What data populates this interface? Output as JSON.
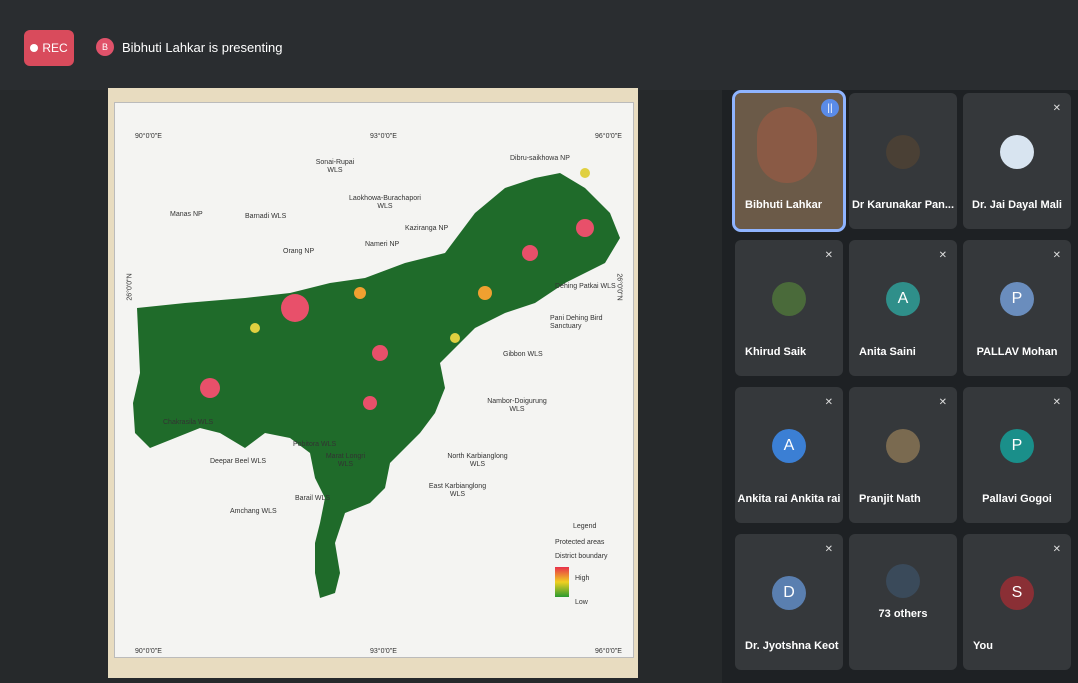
{
  "topbar": {
    "rec_label": "REC",
    "presenter_initial": "B",
    "presenter_text": "Bibhuti Lahkar is presenting"
  },
  "map": {
    "top_coords": [
      "90°0'0\"E",
      "93°0'0\"E",
      "96°0'0\"E"
    ],
    "bottom_coords": [
      "90°0'0\"E",
      "93°0'0\"E",
      "96°0'0\"E"
    ],
    "left_coord": "26°0'0\"N",
    "right_coord": "26°0'0\"N",
    "labels": [
      "Sonai-Rupai WLS",
      "Dibru-saikhowa NP",
      "Laokhowa-Burachapori WLS",
      "Manas NP",
      "Barnadi WLS",
      "Kaziranga NP",
      "Nameri NP",
      "Orang NP",
      "Dehing Patkai WLS",
      "Pani Dehing Bird Sanctuary",
      "Gibbon WLS",
      "Chakrasila WLS",
      "Nambor-Doigurung WLS",
      "Pobitora WLS",
      "Marat Longri WLS",
      "North Karbianglong WLS",
      "Deepar Beel WLS",
      "East Karbianglong WLS",
      "Barail WLS",
      "Amchang WLS"
    ],
    "legend": {
      "title": "Legend",
      "items": [
        "Protected areas",
        "District boundary"
      ],
      "high": "High",
      "low": "Low"
    }
  },
  "participants": [
    {
      "name": "Bibhuti Lahkar"
    },
    {
      "name": "Dr Karunakar Pan..."
    },
    {
      "name": "Dr. Jai Dayal Mali"
    },
    {
      "name": "Khirud Saik"
    },
    {
      "name": "Anita Saini",
      "initial": "A",
      "color": "#2f8f8a"
    },
    {
      "name": "PALLAV Mohan",
      "initial": "P",
      "color": "#6a8dbd"
    },
    {
      "name": "Ankita rai Ankita rai",
      "initial": "A",
      "color": "#3b7fd4"
    },
    {
      "name": "Pranjit Nath"
    },
    {
      "name": "Pallavi Gogoi",
      "initial": "P",
      "color": "#1a8f8a"
    },
    {
      "name": "Dr. Jyotshna Keot",
      "initial": "D",
      "color": "#5a7fb0"
    },
    {
      "name": "73 others"
    },
    {
      "name": "You",
      "initial": "S",
      "color": "#8a2f35"
    }
  ]
}
